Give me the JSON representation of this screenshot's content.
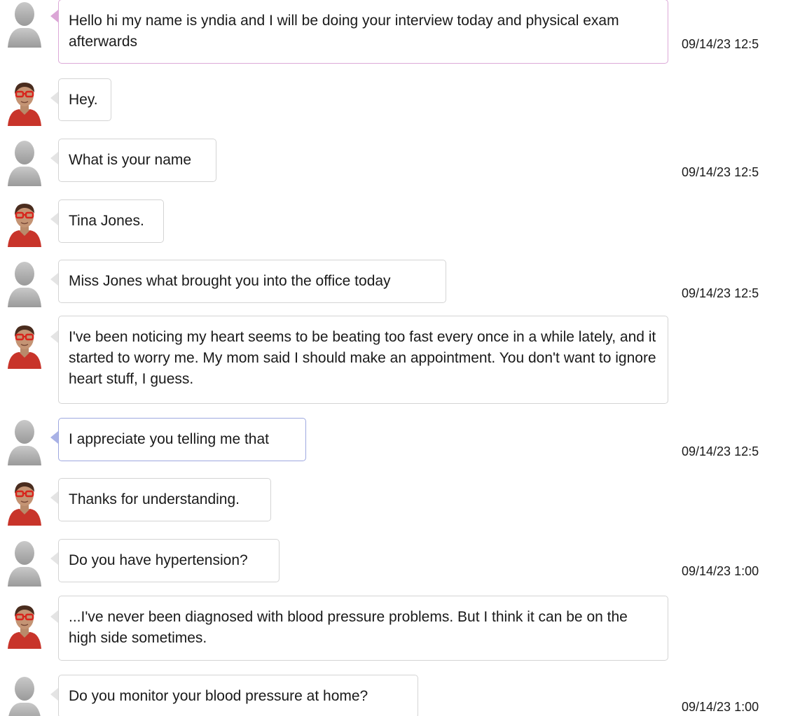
{
  "messages": [
    {
      "speaker": "student",
      "text": "Hello hi my name is yndia and I will be doing your interview today and physical exam afterwards",
      "timestamp": "09/14/23 12:5"
    },
    {
      "speaker": "patient",
      "text": "Hey."
    },
    {
      "speaker": "student",
      "text": "What is your name",
      "timestamp": "09/14/23 12:5"
    },
    {
      "speaker": "patient",
      "text": "Tina Jones."
    },
    {
      "speaker": "student",
      "text": "Miss Jones what brought you into the office today",
      "timestamp": "09/14/23 12:5"
    },
    {
      "speaker": "patient",
      "text": "I've been noticing my heart seems to be beating too fast every once in a while lately, and it started to worry me. My mom said I should make an appointment. You don't want to ignore heart stuff, I guess."
    },
    {
      "speaker": "student",
      "text": "I appreciate you telling me that",
      "timestamp": "09/14/23 12:5"
    },
    {
      "speaker": "patient",
      "text": "Thanks for understanding."
    },
    {
      "speaker": "student",
      "text": "Do you have hypertension?",
      "timestamp": "09/14/23 1:00"
    },
    {
      "speaker": "patient",
      "text": "...I've never been diagnosed with blood pressure problems. But I think it can be on the high side sometimes."
    },
    {
      "speaker": "student",
      "text": "Do you monitor your blood pressure at home?",
      "timestamp": "09/14/23 1:00"
    }
  ],
  "colors": {
    "pink_accent": "#dca9d8",
    "blue_accent": "#9ea8e0",
    "bubble_border": "#d4d4d4"
  },
  "icons": {
    "student": "default-user-avatar-icon",
    "patient": "tina-jones-avatar-icon"
  }
}
